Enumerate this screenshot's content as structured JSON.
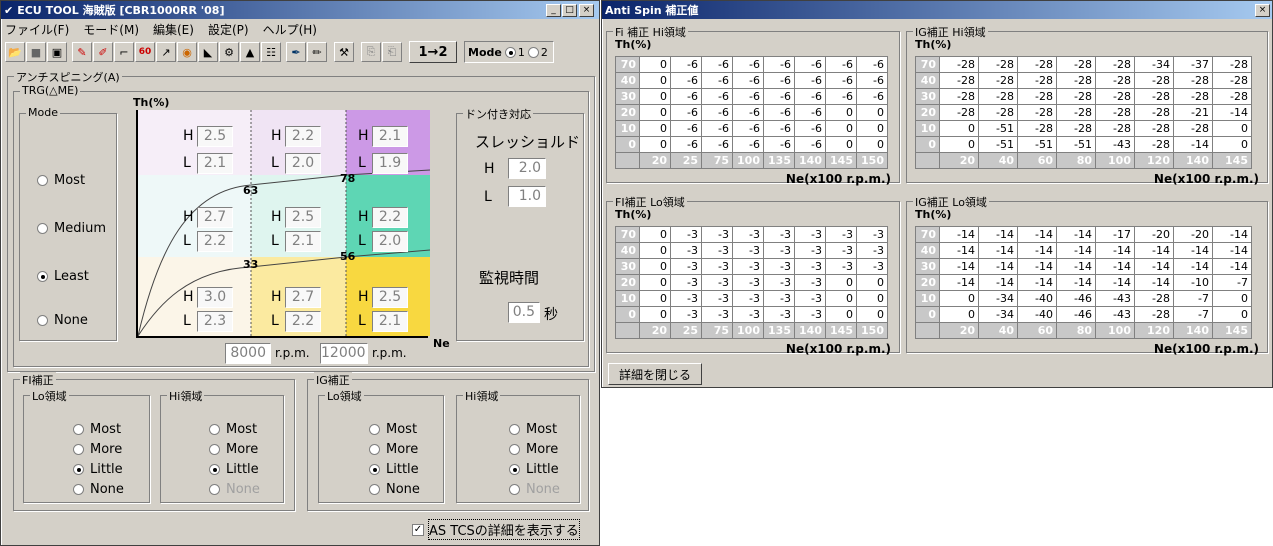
{
  "main": {
    "title": "ECU TOOL 海賊版 [CBR1000RR '08]",
    "menu": [
      "ファイル(F)",
      "モード(M)",
      "編集(E)",
      "設定(P)",
      "ヘルプ(H)"
    ],
    "mode_btn": "1→2",
    "mode_label": "Mode",
    "mode_opts": [
      "1",
      "2"
    ],
    "section": "アンチスピニング(A)",
    "trg": "TRG(△ME)",
    "mode_group": "Mode",
    "modes": [
      "Most",
      "Medium",
      "Least",
      "None"
    ],
    "chart": {
      "th": "Th(%)",
      "ne": "Ne",
      "n63": "63",
      "n78": "78",
      "n33": "33",
      "n56": "56",
      "cells": [
        {
          "h": "2.5",
          "l": "2.1"
        },
        {
          "h": "2.2",
          "l": "2.0"
        },
        {
          "h": "2.1",
          "l": "1.9"
        },
        {
          "h": "2.7",
          "l": "2.2"
        },
        {
          "h": "2.5",
          "l": "2.1"
        },
        {
          "h": "2.2",
          "l": "2.0"
        },
        {
          "h": "3.0",
          "l": "2.3"
        },
        {
          "h": "2.7",
          "l": "2.2"
        },
        {
          "h": "2.5",
          "l": "2.1"
        }
      ],
      "rpm1": "8000",
      "rpm2": "12000",
      "rpm_unit": "r.p.m."
    },
    "don": {
      "title": "ドン付き対応",
      "thr": "スレッショルド",
      "h": "2.0",
      "l": "1.0",
      "mon": "監視時間",
      "sec": "0.5",
      "unit": "秒"
    },
    "fi": "FI補正",
    "ig": "IG補正",
    "lo": "Lo領域",
    "hi": "Hi領域",
    "opts": [
      "Most",
      "More",
      "Little",
      "None"
    ],
    "show": "AS TCSの詳細を表示する"
  },
  "sub": {
    "title": "Anti Spin 補正値",
    "close": "詳細を閉じる",
    "th": "Th(%)",
    "ne": "Ne(x100 r.p.m.)",
    "panels": [
      {
        "title": "Fi 補正 Hi領域",
        "cols": [
          "20",
          "25",
          "75",
          "100",
          "135",
          "140",
          "145",
          "150"
        ],
        "rows": [
          [
            "70",
            [
              "0",
              "-6",
              "-6",
              "-6",
              "-6",
              "-6",
              "-6",
              "-6"
            ]
          ],
          [
            "40",
            [
              "0",
              "-6",
              "-6",
              "-6",
              "-6",
              "-6",
              "-6",
              "-6"
            ]
          ],
          [
            "30",
            [
              "0",
              "-6",
              "-6",
              "-6",
              "-6",
              "-6",
              "-6",
              "-6"
            ]
          ],
          [
            "20",
            [
              "0",
              "-6",
              "-6",
              "-6",
              "-6",
              "-6",
              "0",
              "0"
            ]
          ],
          [
            "10",
            [
              "0",
              "-6",
              "-6",
              "-6",
              "-6",
              "-6",
              "0",
              "0"
            ]
          ],
          [
            "0",
            [
              "0",
              "-6",
              "-6",
              "-6",
              "-6",
              "-6",
              "0",
              "0"
            ]
          ]
        ]
      },
      {
        "title": "IG補正 Hi領域",
        "cols": [
          "20",
          "40",
          "60",
          "80",
          "100",
          "120",
          "140",
          "145"
        ],
        "rows": [
          [
            "70",
            [
              "-28",
              "-28",
              "-28",
              "-28",
              "-28",
              "-34",
              "-37",
              "-28"
            ]
          ],
          [
            "40",
            [
              "-28",
              "-28",
              "-28",
              "-28",
              "-28",
              "-28",
              "-28",
              "-28"
            ]
          ],
          [
            "30",
            [
              "-28",
              "-28",
              "-28",
              "-28",
              "-28",
              "-28",
              "-28",
              "-28"
            ]
          ],
          [
            "20",
            [
              "-28",
              "-28",
              "-28",
              "-28",
              "-28",
              "-28",
              "-21",
              "-14"
            ]
          ],
          [
            "10",
            [
              "0",
              "-51",
              "-28",
              "-28",
              "-28",
              "-28",
              "-28",
              "0"
            ]
          ],
          [
            "0",
            [
              "0",
              "-51",
              "-51",
              "-51",
              "-43",
              "-28",
              "-14",
              "0"
            ]
          ]
        ]
      },
      {
        "title": "FI補正 Lo領域",
        "cols": [
          "20",
          "25",
          "75",
          "100",
          "135",
          "140",
          "145",
          "150"
        ],
        "rows": [
          [
            "70",
            [
              "0",
              "-3",
              "-3",
              "-3",
              "-3",
              "-3",
              "-3",
              "-3"
            ]
          ],
          [
            "40",
            [
              "0",
              "-3",
              "-3",
              "-3",
              "-3",
              "-3",
              "-3",
              "-3"
            ]
          ],
          [
            "30",
            [
              "0",
              "-3",
              "-3",
              "-3",
              "-3",
              "-3",
              "-3",
              "-3"
            ]
          ],
          [
            "20",
            [
              "0",
              "-3",
              "-3",
              "-3",
              "-3",
              "-3",
              "0",
              "0"
            ]
          ],
          [
            "10",
            [
              "0",
              "-3",
              "-3",
              "-3",
              "-3",
              "-3",
              "0",
              "0"
            ]
          ],
          [
            "0",
            [
              "0",
              "-3",
              "-3",
              "-3",
              "-3",
              "-3",
              "0",
              "0"
            ]
          ]
        ]
      },
      {
        "title": "IG補正 Lo領域",
        "cols": [
          "20",
          "40",
          "60",
          "80",
          "100",
          "120",
          "140",
          "145"
        ],
        "rows": [
          [
            "70",
            [
              "-14",
              "-14",
              "-14",
              "-14",
              "-17",
              "-20",
              "-20",
              "-14"
            ]
          ],
          [
            "40",
            [
              "-14",
              "-14",
              "-14",
              "-14",
              "-14",
              "-14",
              "-14",
              "-14"
            ]
          ],
          [
            "30",
            [
              "-14",
              "-14",
              "-14",
              "-14",
              "-14",
              "-14",
              "-14",
              "-14"
            ]
          ],
          [
            "20",
            [
              "-14",
              "-14",
              "-14",
              "-14",
              "-14",
              "-14",
              "-10",
              "-7"
            ]
          ],
          [
            "10",
            [
              "0",
              "-34",
              "-40",
              "-46",
              "-43",
              "-28",
              "-7",
              "0"
            ]
          ],
          [
            "0",
            [
              "0",
              "-34",
              "-40",
              "-46",
              "-43",
              "-28",
              "-7",
              "0"
            ]
          ]
        ]
      }
    ]
  }
}
